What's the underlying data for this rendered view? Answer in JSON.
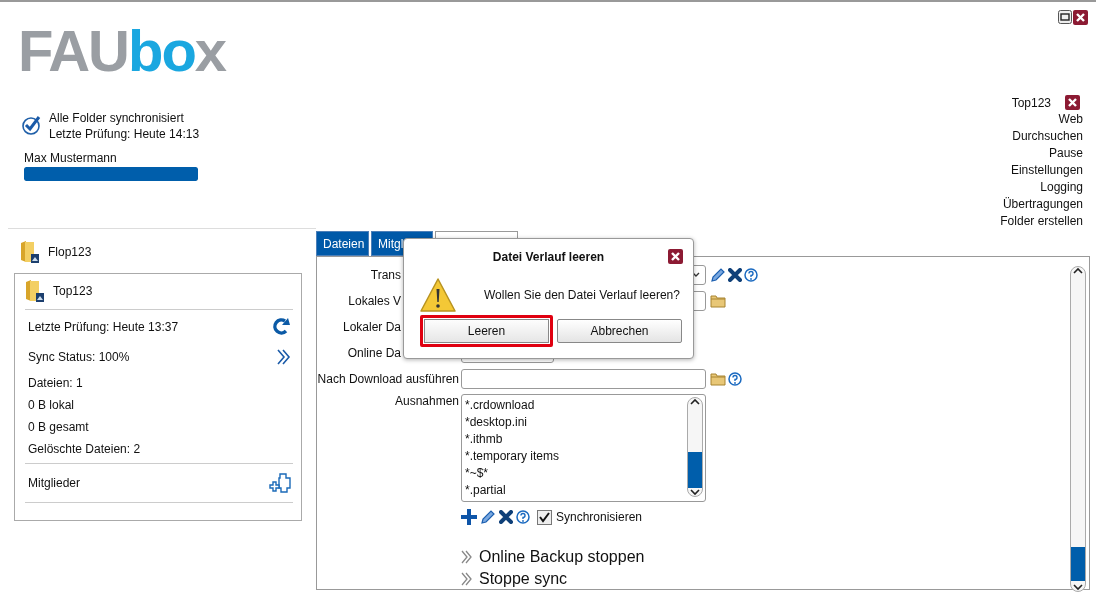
{
  "logo": [
    {
      "text": "FAU",
      "kind": "striped"
    },
    {
      "text": "bo",
      "kind": "solid"
    },
    {
      "text": "x",
      "kind": "striped"
    }
  ],
  "status": {
    "lines": [
      "Alle Folder synchronisiert",
      "Letzte Prüfung: Heute 14:13"
    ]
  },
  "user": {
    "name": "Max Mustermann",
    "level": 1
  },
  "menu": {
    "folder": "Top123",
    "links": [
      "Web",
      "Durchsuchen",
      "Pause",
      "Einstellungen",
      "Logging",
      "Übertragungen",
      "Folder erstellen"
    ]
  },
  "sidebar": {
    "folders": [
      {
        "name": "Flop123",
        "expanded": false
      },
      {
        "name": "Top123",
        "expanded": true,
        "details": [
          {
            "text": "Letzte Prüfung: Heute 13:37",
            "kind": "refresh"
          },
          {
            "text": "Sync Status: 100%",
            "kind": "more"
          },
          {
            "text": "Dateien: 1",
            "kind": "plain"
          },
          {
            "text": "0 B lokal",
            "kind": "plain"
          },
          {
            "text": "0 B gesamt",
            "kind": "plain"
          },
          {
            "text": "Gelöschte Dateien: 2",
            "kind": "plain"
          }
        ],
        "members": "Mitglieder"
      }
    ]
  },
  "tabs": [
    {
      "label": "Dateien",
      "selected": false
    },
    {
      "label": "Mitgl",
      "selected": false
    },
    {
      "selected": true
    }
  ],
  "form": {
    "rows": [
      {
        "label": "Trans",
        "kind": "select"
      },
      {
        "label": "Lokales V",
        "kind": "folder"
      },
      {
        "label": "Lokaler Da",
        "kind": "none"
      },
      {
        "label": "Online Da",
        "kind": "short"
      },
      {
        "label": "Nach Download ausführen",
        "kind": "file"
      },
      {
        "label": "Ausnahmen",
        "kind": "list",
        "items": [
          "*.crdownload",
          "*desktop.ini",
          "*.ithmb",
          "*.temporary items",
          "*~$*",
          "*.partial"
        ]
      }
    ],
    "sync_checkbox": {
      "label": "Synchronisieren",
      "checked": true
    }
  },
  "actions": [
    "Online Backup stoppen",
    "Stoppe sync"
  ],
  "dialog": {
    "title": "Datei Verlauf leeren",
    "message": "Wollen Sie den Datei Verlauf leeren?",
    "buttons": [
      {
        "label": "Leeren",
        "focused": true
      },
      {
        "label": "Abbrechen",
        "focused": false
      }
    ]
  }
}
